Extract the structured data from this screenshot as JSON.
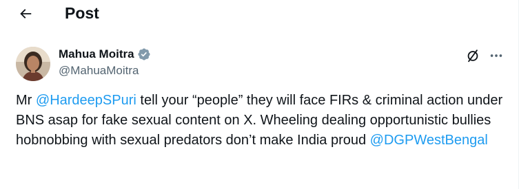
{
  "header": {
    "title": "Post"
  },
  "author": {
    "display_name": "Mahua Moitra",
    "handle": "@MahuaMoitra"
  },
  "tweet": {
    "part1": "Mr ",
    "mention1": "@HardeepSPuri",
    "part2": " tell your “people” they will face FIRs & criminal action under BNS asap for fake sexual content on X. Wheeling dealing opportunistic bullies hobnobbing with sexual predators don’t make India proud ",
    "mention2": "@DGPWestBengal"
  },
  "colors": {
    "accent": "#1d9bf0",
    "text": "#0f1419",
    "secondary_text": "#536471"
  },
  "icons": {
    "back": "back-arrow-icon",
    "verified": "verified-badge-icon",
    "grok": "grok-icon",
    "more": "more-dots-icon"
  }
}
